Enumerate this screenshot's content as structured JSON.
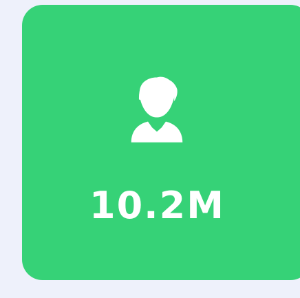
{
  "card": {
    "value": "10.2M",
    "icon": "user-icon",
    "background_color": "#36d277",
    "text_color": "#ffffff"
  },
  "page": {
    "background_color": "#eef1fb"
  }
}
